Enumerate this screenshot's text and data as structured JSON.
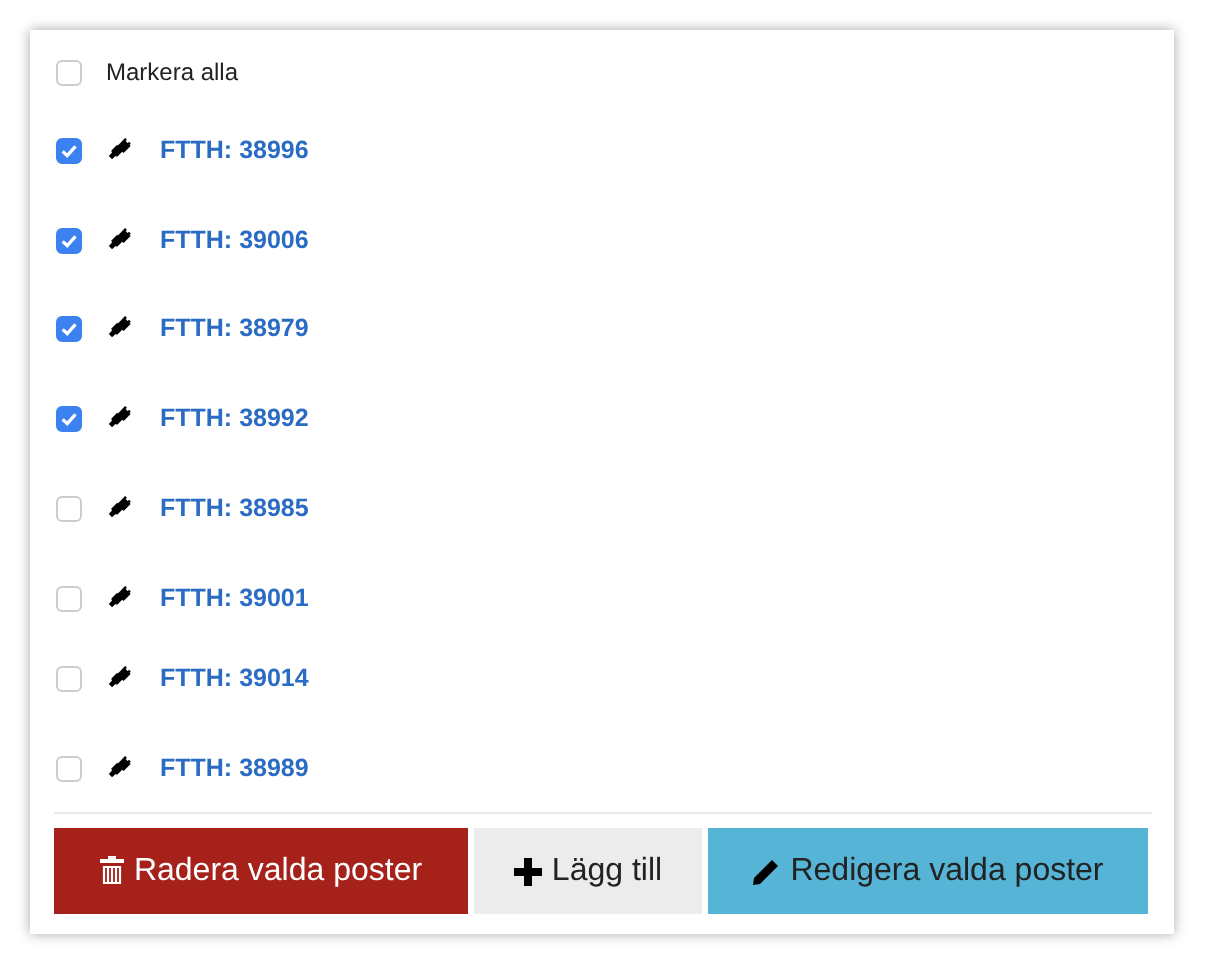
{
  "select_all": {
    "label": "Markera alla",
    "checked": false
  },
  "items": [
    {
      "label": "FTTH: 38996",
      "checked": true
    },
    {
      "label": "FTTH: 39006",
      "checked": true
    },
    {
      "label": "FTTH: 38979",
      "checked": true
    },
    {
      "label": "FTTH: 38992",
      "checked": true
    },
    {
      "label": "FTTH: 38985",
      "checked": false
    },
    {
      "label": "FTTH: 39001",
      "checked": false
    },
    {
      "label": "FTTH: 39014",
      "checked": false
    },
    {
      "label": "FTTH: 38989",
      "checked": false
    }
  ],
  "buttons": [
    {
      "label": "Radera valda poster",
      "kind": "delete"
    },
    {
      "label": "Lägg till",
      "kind": "add"
    },
    {
      "label": "Redigera valda poster",
      "kind": "edit"
    }
  ]
}
